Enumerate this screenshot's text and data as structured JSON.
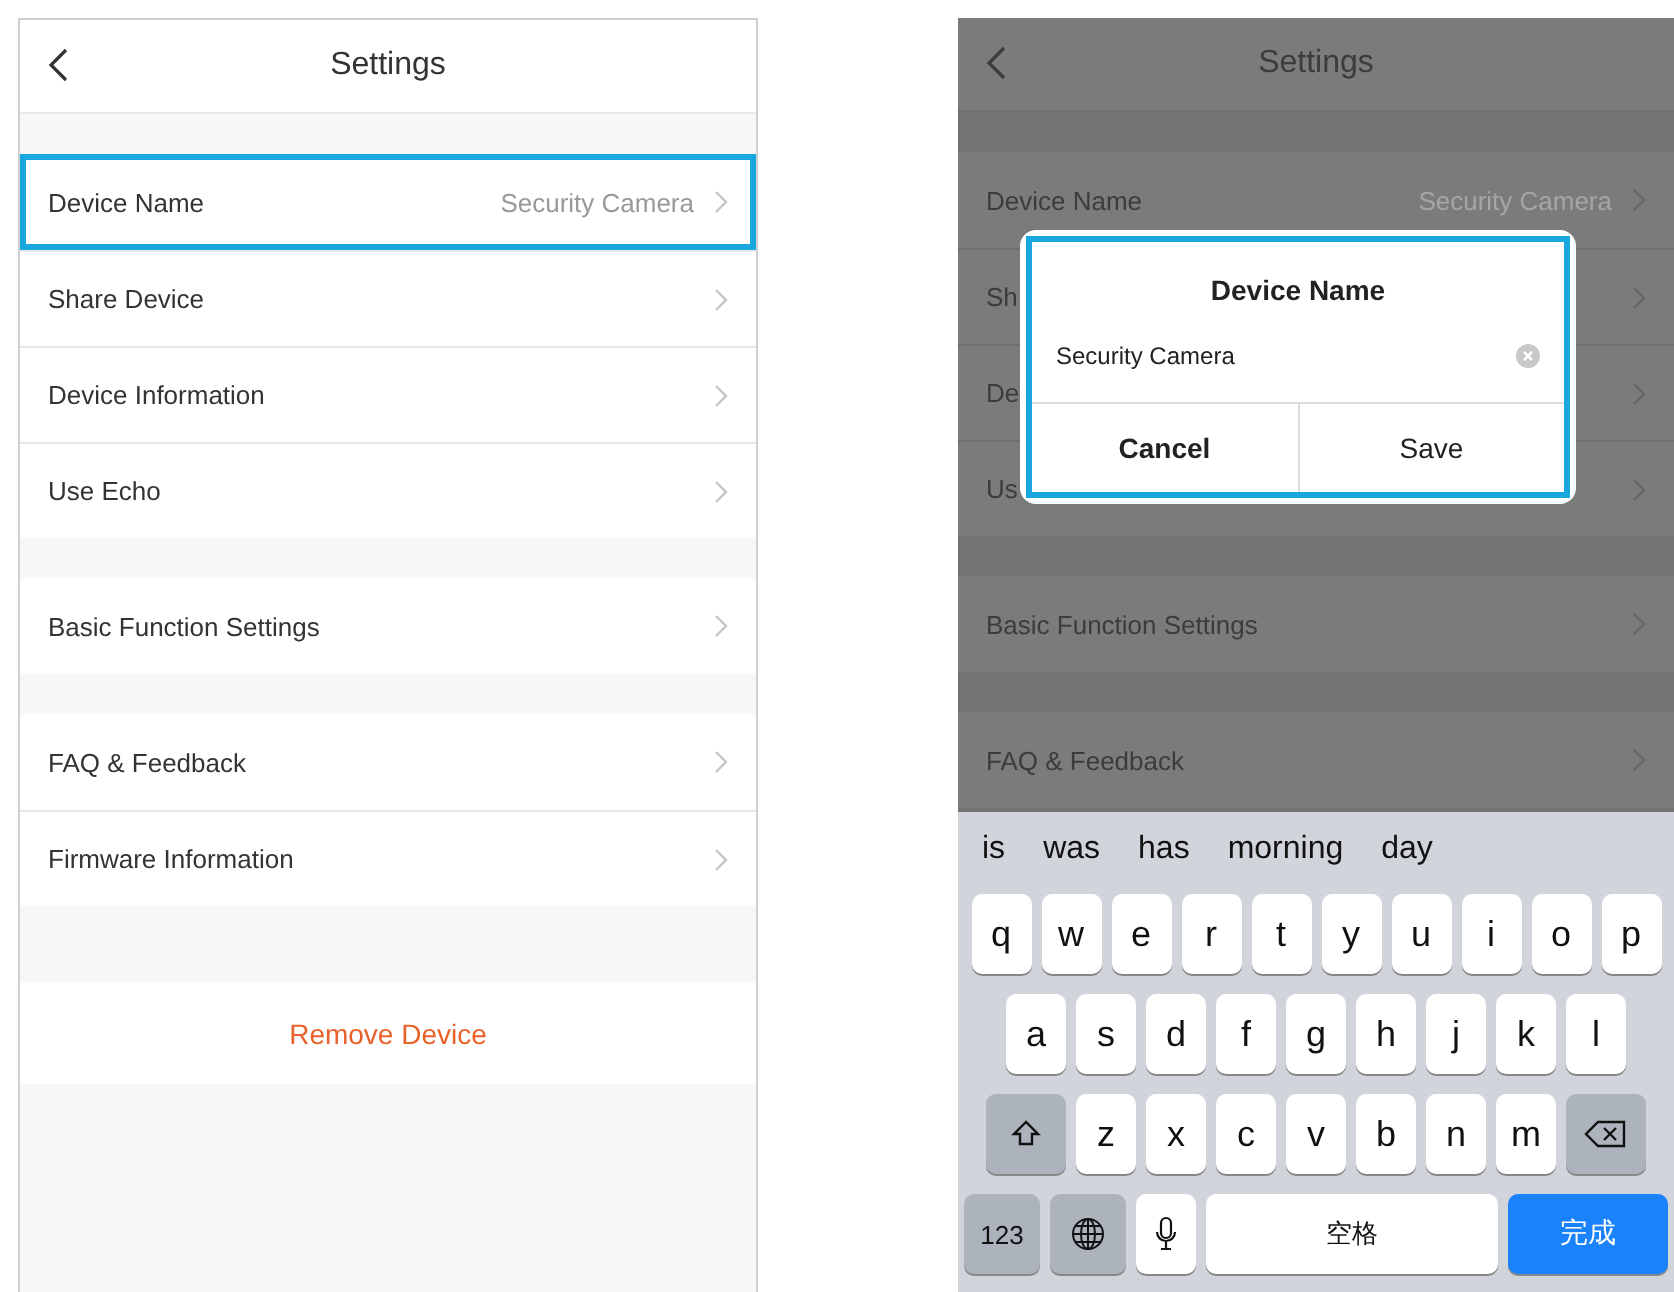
{
  "screens": [
    {
      "dimmed": false,
      "header": {
        "title": "Settings"
      },
      "sections": [
        [
          {
            "label": "Device Name",
            "value": "Security Camera",
            "highlighted": true
          },
          {
            "label": "Share Device",
            "highlighted": false
          },
          {
            "label": "Device Information",
            "highlighted": false
          },
          {
            "label": "Use Echo",
            "highlighted": false
          }
        ],
        [
          {
            "label": "Basic Function Settings",
            "highlighted": false
          }
        ],
        [
          {
            "label": "FAQ & Feedback",
            "highlighted": false
          },
          {
            "label": "Firmware Information",
            "highlighted": false
          }
        ]
      ],
      "remove_button": "Remove Device"
    },
    {
      "dimmed": true,
      "header": {
        "title": "Settings"
      },
      "sections": [
        [
          {
            "label": "Device Name",
            "value": "Security Camera",
            "highlighted": false
          },
          {
            "label": "Sh",
            "highlighted": false
          },
          {
            "label": "De",
            "highlighted": false
          },
          {
            "label": "Us",
            "highlighted": false
          }
        ],
        [
          {
            "label": "Basic Function Settings",
            "highlighted": false
          }
        ],
        [
          {
            "label": "FAQ & Feedback",
            "highlighted": false
          }
        ]
      ],
      "dialog": {
        "title": "Device Name",
        "value": "Security Camera",
        "highlighted": true,
        "buttons": [
          {
            "label": "Cancel",
            "kind": "cancel"
          },
          {
            "label": "Save",
            "kind": "confirm"
          }
        ]
      },
      "keyboard": {
        "suggestions": [
          "is",
          "was",
          "has",
          "morning",
          "day"
        ],
        "rows": [
          [
            {
              "kind": "letter",
              "label": "q"
            },
            {
              "kind": "letter",
              "label": "w"
            },
            {
              "kind": "letter",
              "label": "e"
            },
            {
              "kind": "letter",
              "label": "r"
            },
            {
              "kind": "letter",
              "label": "t"
            },
            {
              "kind": "letter",
              "label": "y"
            },
            {
              "kind": "letter",
              "label": "u"
            },
            {
              "kind": "letter",
              "label": "i"
            },
            {
              "kind": "letter",
              "label": "o"
            },
            {
              "kind": "letter",
              "label": "p"
            }
          ],
          [
            {
              "kind": "letter",
              "label": "a"
            },
            {
              "kind": "letter",
              "label": "s"
            },
            {
              "kind": "letter",
              "label": "d"
            },
            {
              "kind": "letter",
              "label": "f"
            },
            {
              "kind": "letter",
              "label": "g"
            },
            {
              "kind": "letter",
              "label": "h"
            },
            {
              "kind": "letter",
              "label": "j"
            },
            {
              "kind": "letter",
              "label": "k"
            },
            {
              "kind": "letter",
              "label": "l"
            }
          ],
          [
            {
              "kind": "shift"
            },
            {
              "kind": "letter",
              "label": "z"
            },
            {
              "kind": "letter",
              "label": "x"
            },
            {
              "kind": "letter",
              "label": "c"
            },
            {
              "kind": "letter",
              "label": "v"
            },
            {
              "kind": "letter",
              "label": "b"
            },
            {
              "kind": "letter",
              "label": "n"
            },
            {
              "kind": "letter",
              "label": "m"
            },
            {
              "kind": "backspace"
            }
          ],
          [
            {
              "kind": "numbers",
              "label": "123"
            },
            {
              "kind": "globe"
            },
            {
              "kind": "mic"
            },
            {
              "kind": "space",
              "label": "空格"
            },
            {
              "kind": "done",
              "label": "完成"
            }
          ]
        ]
      }
    }
  ]
}
